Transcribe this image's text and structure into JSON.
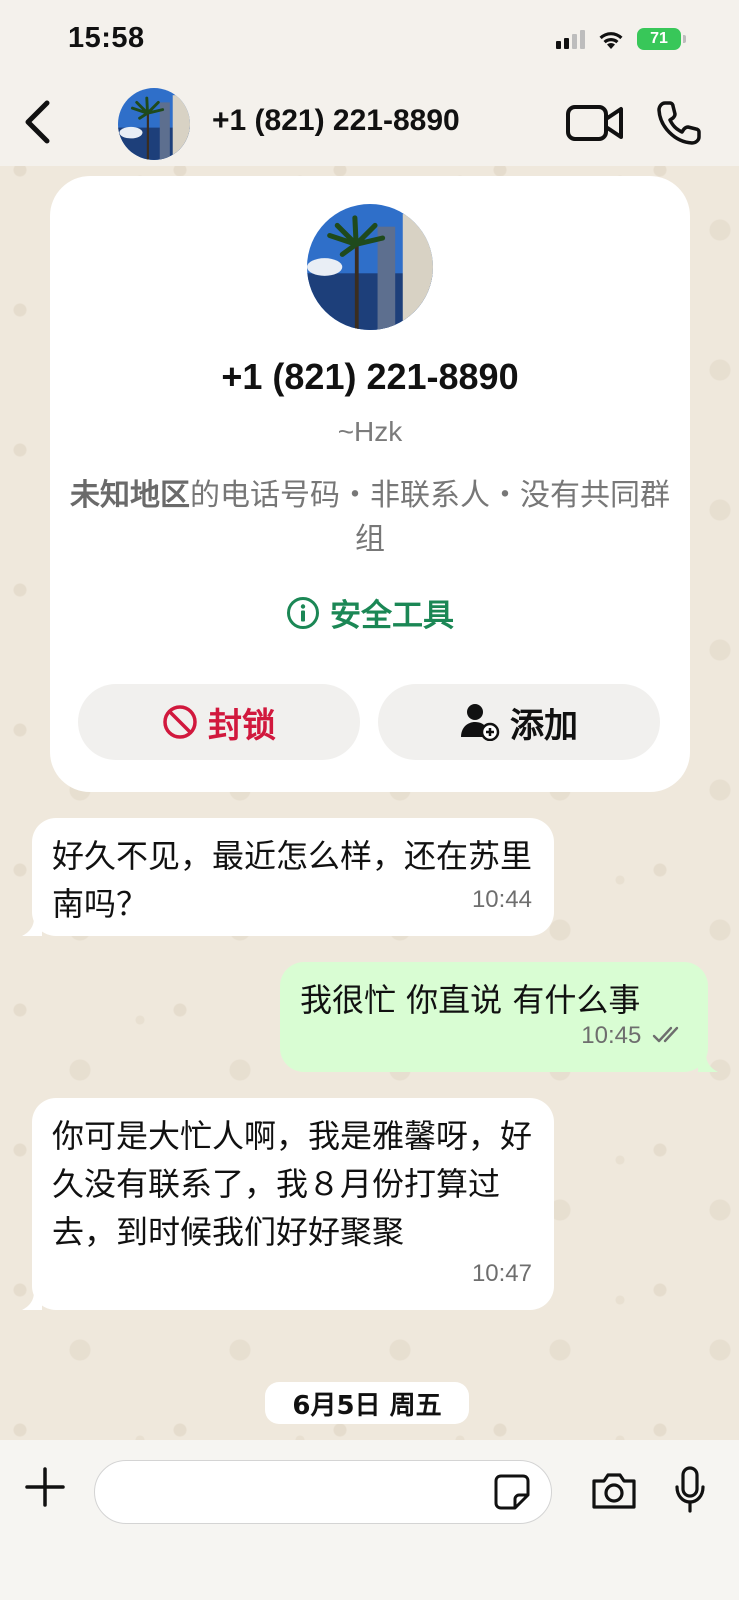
{
  "status_bar": {
    "time": "15:58",
    "battery": "71"
  },
  "header": {
    "title": "+1 (821) 221-8890"
  },
  "contact_card": {
    "phone": "+1 (821) 221-8890",
    "username": "~Hzk",
    "info_bold": "未知地区",
    "info_rest": "的电话号码・非联系人・没有共同群组",
    "safety_tools": "安全工具",
    "block_label": "封锁",
    "add_label": "添加"
  },
  "messages": [
    {
      "direction": "incoming",
      "text": "好久不见，最近怎么样，还在苏里南吗？",
      "time": "10:44"
    },
    {
      "direction": "outgoing",
      "text": "我很忙 你直说 有什么事",
      "time": "10:45",
      "status": "read"
    },
    {
      "direction": "incoming",
      "text": "你可是大忙人啊，我是雅馨呀，好久没有联系了，我８月份打算过去，到时候我们好好聚聚",
      "time": "10:47"
    }
  ],
  "date_separator": "6月5日 周五",
  "composer": {
    "input_value": "",
    "input_placeholder": ""
  },
  "colors": {
    "accent_green": "#1b8755",
    "block_red": "#d1183d",
    "outgoing_bubble": "#d9fdd3",
    "battery_green": "#38c759"
  }
}
